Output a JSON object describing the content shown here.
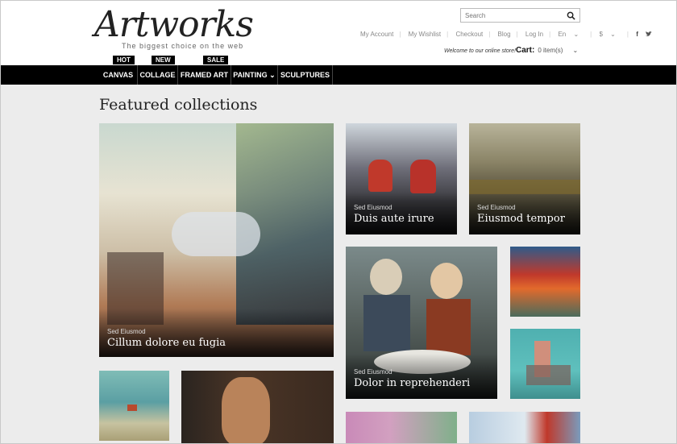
{
  "logo": {
    "text": "Artworks",
    "tagline": "The biggest choice on the web"
  },
  "search": {
    "placeholder": "Search"
  },
  "toplinks": [
    "My Account",
    "My Wishlist",
    "Checkout",
    "Blog",
    "Log In",
    "En",
    "$"
  ],
  "welcome": "Welcome to our online store!",
  "cart": {
    "label": "Cart:",
    "count": "0 item(s)"
  },
  "badges": [
    "HOT",
    "NEW",
    "SALE"
  ],
  "nav": [
    "CANVAS",
    "COLLAGE",
    "FRAMED ART",
    "PAINTING",
    "SCULPTURES"
  ],
  "section_title": "Featured collections",
  "tiles": [
    {
      "sub": "Sed Eiusmod",
      "title": "Cillum dolore eu fugia"
    },
    {
      "sub": "Sed Eiusmod",
      "title": "Duis aute irure"
    },
    {
      "sub": "Sed Eiusmod",
      "title": "Eiusmod tempor"
    },
    {
      "sub": "Sed Eiusmod",
      "title": "Dolor in reprehenderi"
    }
  ],
  "colors": {
    "nav_bg": "#000000",
    "accent": "#000000",
    "page_bg": "#ececec"
  }
}
